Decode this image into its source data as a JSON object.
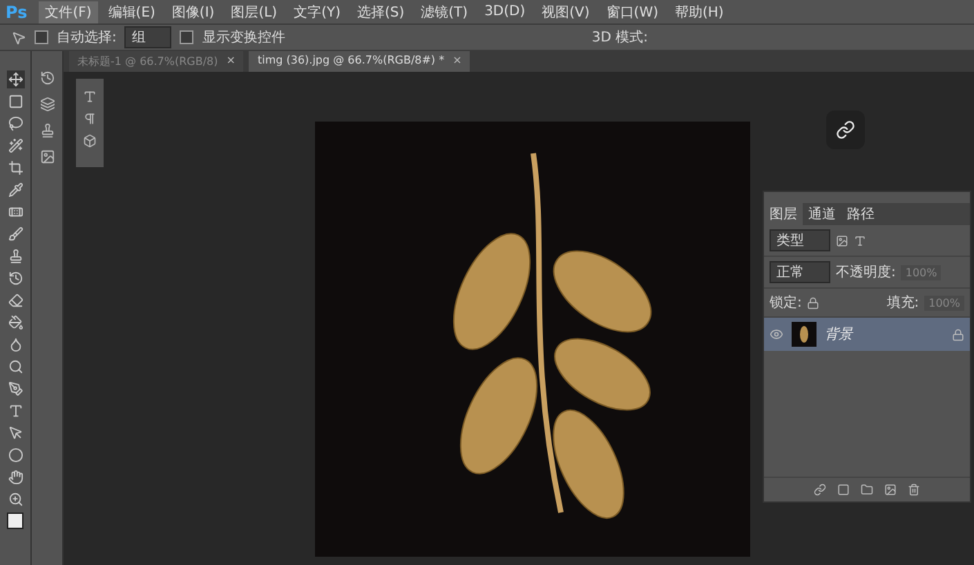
{
  "app": {
    "logo": "Ps"
  },
  "menu": [
    {
      "label": "文件(F)",
      "selected": true
    },
    {
      "label": "编辑(E)",
      "selected": false
    },
    {
      "label": "图像(I)",
      "selected": false
    },
    {
      "label": "图层(L)",
      "selected": false
    },
    {
      "label": "文字(Y)",
      "selected": false
    },
    {
      "label": "选择(S)",
      "selected": false
    },
    {
      "label": "滤镜(T)",
      "selected": false
    },
    {
      "label": "3D(D)",
      "selected": false
    },
    {
      "label": "视图(V)",
      "selected": false
    },
    {
      "label": "窗口(W)",
      "selected": false
    },
    {
      "label": "帮助(H)",
      "selected": false
    }
  ],
  "options_bar": {
    "auto_select": {
      "label": "自动选择:",
      "checked": false
    },
    "auto_select_target": "组",
    "show_transform": {
      "label": "显示变换控件",
      "checked": false
    },
    "mode_3d": "3D 模式:"
  },
  "tabs": [
    {
      "label": "未标题-1 @ 66.7%(RGB/8)",
      "close": "×",
      "selected": false
    },
    {
      "label": "timg (36).jpg @ 66.7%(RGB/8#) *",
      "close": "×",
      "selected": true
    }
  ],
  "layers_panel": {
    "tabs": [
      {
        "label": "图层",
        "selected": true
      },
      {
        "label": "通道",
        "selected": false
      },
      {
        "label": "路径",
        "selected": false
      }
    ],
    "filter": "类型",
    "blend_mode": "正常",
    "opacity_label": "不透明度:",
    "opacity": "100%",
    "lock_label": "锁定:",
    "fill_label": "填充:",
    "fill": "100%",
    "layers": [
      {
        "name": "背景",
        "visible": true,
        "selected": true,
        "locked": true
      }
    ]
  }
}
